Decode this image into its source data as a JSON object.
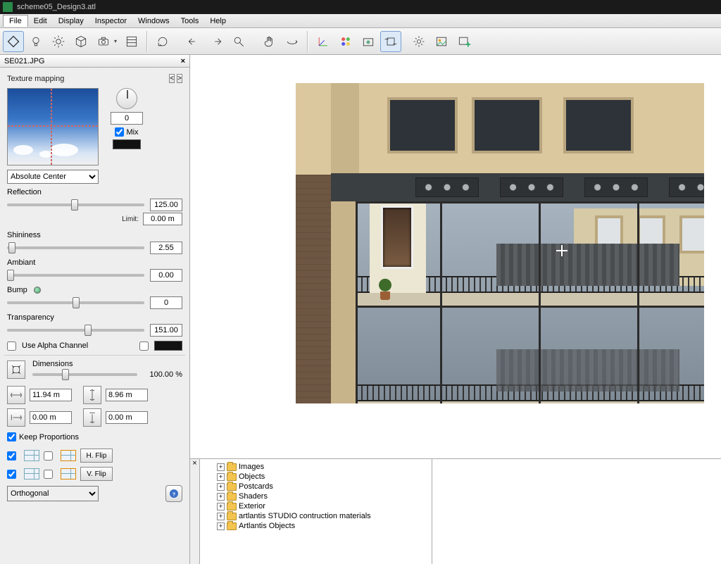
{
  "title": "scheme05_Design3.atl",
  "menu": [
    "File",
    "Edit",
    "Display",
    "Inspector",
    "Windows",
    "Tools",
    "Help"
  ],
  "panel": {
    "title": "SE021.JPG",
    "mapping_label": "Texture mapping",
    "rotation_value": "0",
    "mix_label": "Mix",
    "anchor_selected": "Absolute Center",
    "reflection": {
      "label": "Reflection",
      "value": "125.00",
      "limit_label": "Limit:",
      "limit_value": "0.00 m"
    },
    "shininess": {
      "label": "Shininess",
      "value": "2.55"
    },
    "ambiant": {
      "label": "Ambiant",
      "value": "0.00"
    },
    "bump": {
      "label": "Bump",
      "value": "0"
    },
    "transparency": {
      "label": "Transparency",
      "value": "151.00"
    },
    "alpha_label": "Use Alpha Channel",
    "dimensions_label": "Dimensions",
    "scale_value": "100.00 %",
    "width_value": "11.94 m",
    "height_value": "8.96 m",
    "offx_value": "0.00 m",
    "offy_value": "0.00 m",
    "keep_label": "Keep Proportions",
    "hflip_label": "H. Flip",
    "vflip_label": "V. Flip",
    "projection_selected": "Orthogonal"
  },
  "catalog": [
    "Images",
    "Objects",
    "Postcards",
    "Shaders",
    "Exterior",
    "artlantis STUDIO contruction materials",
    "Artlantis Objects"
  ]
}
